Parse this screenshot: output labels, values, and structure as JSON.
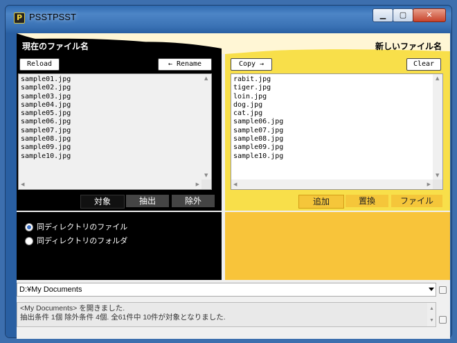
{
  "window": {
    "title": "PSSTPSST",
    "icon": "app-logo-icon"
  },
  "labels": {
    "current_name": "現在のファイル名",
    "new_name": "新しいファイル名"
  },
  "buttons": {
    "reload": "Reload",
    "rename": "← Rename",
    "copy": "Copy →",
    "clear": "Clear"
  },
  "left_list": [
    "sample01.jpg",
    "sample02.jpg",
    "sample03.jpg",
    "sample04.jpg",
    "sample05.jpg",
    "sample06.jpg",
    "sample07.jpg",
    "sample08.jpg",
    "sample09.jpg",
    "sample10.jpg"
  ],
  "right_list": [
    "rabit.jpg",
    "tiger.jpg",
    "loin.jpg",
    "dog.jpg",
    "cat.jpg",
    "sample06.jpg",
    "sample07.jpg",
    "sample08.jpg",
    "sample09.jpg",
    "sample10.jpg"
  ],
  "left_tabs": [
    "対象",
    "抽出",
    "除外"
  ],
  "right_tabs": [
    "追加",
    "置換",
    "ファイル"
  ],
  "radios": [
    {
      "label": "同ディレクトリのファイル",
      "checked": true
    },
    {
      "label": "同ディレクトリのフォルダ",
      "checked": false
    }
  ],
  "path": "D:¥My Documents",
  "status_lines": [
    "<My Documents> を開きました.",
    "抽出条件 1個 除外条件 4個. 全61件中 10件が対象となりました."
  ],
  "colors": {
    "title_bar": "#3a72b5",
    "left_panel": "#000000",
    "right_panel": "#f8df4a",
    "right_lower": "#f8c43a",
    "banner": "#fff6d5"
  }
}
